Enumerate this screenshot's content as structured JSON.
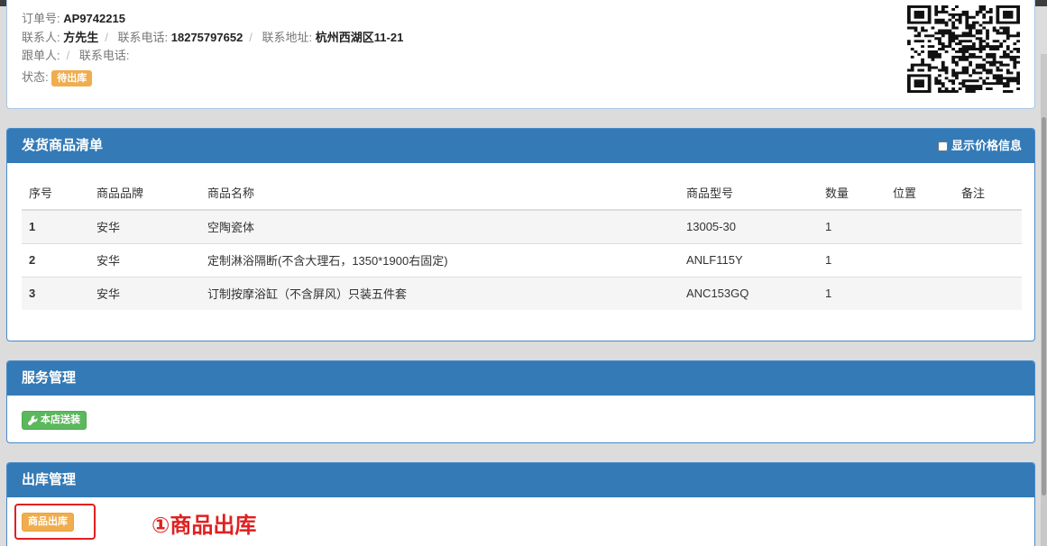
{
  "order": {
    "order_no_label": "订单号:",
    "order_no": "AP9742215",
    "contact_label": "联系人:",
    "contact": "方先生",
    "phone_label": "联系电话:",
    "phone": "18275797652",
    "address_label": "联系地址:",
    "address": "杭州西湖区11-21",
    "follower_label": "跟单人:",
    "follower_phone_label": "联系电话:",
    "status_label": "状态:",
    "status": "待出库"
  },
  "goods_panel": {
    "title": "发货商品清单",
    "price_toggle_label": "显示价格信息",
    "columns": [
      "序号",
      "商品品牌",
      "商品名称",
      "商品型号",
      "数量",
      "位置",
      "备注"
    ],
    "rows": [
      {
        "idx": "1",
        "brand": "安华",
        "name": "空陶瓷体",
        "model": "13005-30",
        "qty": "1",
        "location": "",
        "remark": ""
      },
      {
        "idx": "2",
        "brand": "安华",
        "name": "定制淋浴隔断(不含大理石，1350*1900右固定)",
        "model": "ANLF115Y",
        "qty": "1",
        "location": "",
        "remark": ""
      },
      {
        "idx": "3",
        "brand": "安华",
        "name": "订制按摩浴缸（不含屏风）只装五件套",
        "model": "ANC153GQ",
        "qty": "1",
        "location": "",
        "remark": ""
      }
    ]
  },
  "service_panel": {
    "title": "服务管理",
    "install_button": "本店送装",
    "install_icon": "wrench-icon"
  },
  "outbound_panel": {
    "title": "出库管理",
    "outbound_button": "商品出库",
    "annotation": "①商品出库"
  },
  "colors": {
    "panel_header": "#337ab7",
    "badge_orange": "#f0ad4e",
    "button_green": "#5cb85c",
    "annotation_red": "#e02020"
  }
}
